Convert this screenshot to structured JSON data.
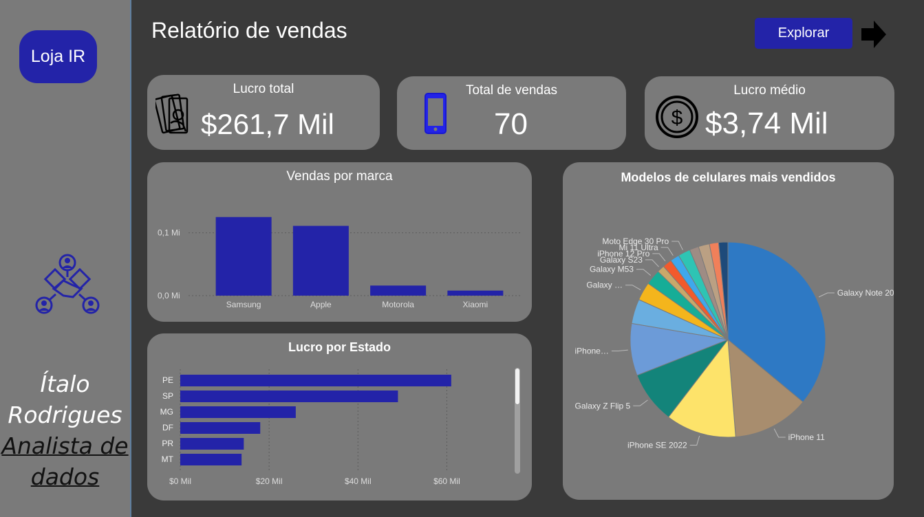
{
  "sidebar": {
    "brand": "Loja IR",
    "author_name_line1": "Ítalo",
    "author_name_line2": "Rodrigues",
    "author_role_line1": "Analista de",
    "author_role_line2": "dados"
  },
  "header": {
    "title": "Relatório de vendas",
    "explore_label": "Explorar"
  },
  "kpis": [
    {
      "title": "Lucro total",
      "value": "$261,7 Mil",
      "icon": "money-icon"
    },
    {
      "title": "Total de vendas",
      "value": "70",
      "icon": "phone-icon"
    },
    {
      "title": "Lucro médio",
      "value": "$3,74 Mil",
      "icon": "dollar-coin-icon"
    }
  ],
  "colors": {
    "accent": "#2323a8",
    "card": "#7a7a7a",
    "background": "#3a3a3a"
  },
  "chart_data": [
    {
      "type": "bar",
      "title": "Vendas por marca",
      "categories": [
        "Samsung",
        "Apple",
        "Motorola",
        "Xiaomi"
      ],
      "values": [
        0.125,
        0.111,
        0.016,
        0.008
      ],
      "ytick_labels": [
        "0,0 Mi",
        "0,1 Mi"
      ],
      "yticks": [
        0,
        0.1
      ],
      "ylim": [
        0,
        0.14
      ],
      "grid": true
    },
    {
      "type": "bar",
      "orientation": "horizontal",
      "title": "Lucro por Estado",
      "categories": [
        "PE",
        "SP",
        "MG",
        "DF",
        "PR",
        "MT"
      ],
      "values": [
        61,
        49,
        26,
        18,
        14.3,
        13.8
      ],
      "xtick_labels": [
        "$0 Mil",
        "$20 Mil",
        "$40 Mil",
        "$60 Mil"
      ],
      "xticks": [
        0,
        20,
        40,
        60
      ],
      "grid": true
    },
    {
      "type": "pie",
      "title": "Modelos de celulares mais vendidos",
      "slices": [
        {
          "label": "Galaxy Note 20",
          "value": 35.5,
          "color": "#2e79c4"
        },
        {
          "label": "iPhone 11",
          "value": 12.5,
          "color": "#a88d6e"
        },
        {
          "label": "iPhone SE 2022",
          "value": 11.5,
          "color": "#fde36a"
        },
        {
          "label": "Galaxy Z Flip 5",
          "value": 8.5,
          "color": "#13847a"
        },
        {
          "label": "iPhone…",
          "value": 8.5,
          "color": "#6c9bd8"
        },
        {
          "label": "",
          "value": 4,
          "color": "#6aaee0"
        },
        {
          "label": "Galaxy …",
          "value": 3,
          "color": "#f4b51c"
        },
        {
          "label": "Galaxy M53",
          "value": 2.5,
          "color": "#16ad97"
        },
        {
          "label": "Galaxy S23",
          "value": 1.2,
          "color": "#c9a86a"
        },
        {
          "label": "iPhone 12 Pro",
          "value": 1.5,
          "color": "#f25a2c"
        },
        {
          "label": "Mi 11 Ultra",
          "value": 1.5,
          "color": "#3ea8ec"
        },
        {
          "label": "Moto Edge 30 Pro",
          "value": 2,
          "color": "#2ec4b4"
        },
        {
          "label": "",
          "value": 1.5,
          "color": "#9e8c84"
        },
        {
          "label": "",
          "value": 1.8,
          "color": "#bba083"
        },
        {
          "label": "",
          "value": 1.5,
          "color": "#f0805a"
        },
        {
          "label": "",
          "value": 1.5,
          "color": "#1e4a7a"
        }
      ]
    }
  ]
}
